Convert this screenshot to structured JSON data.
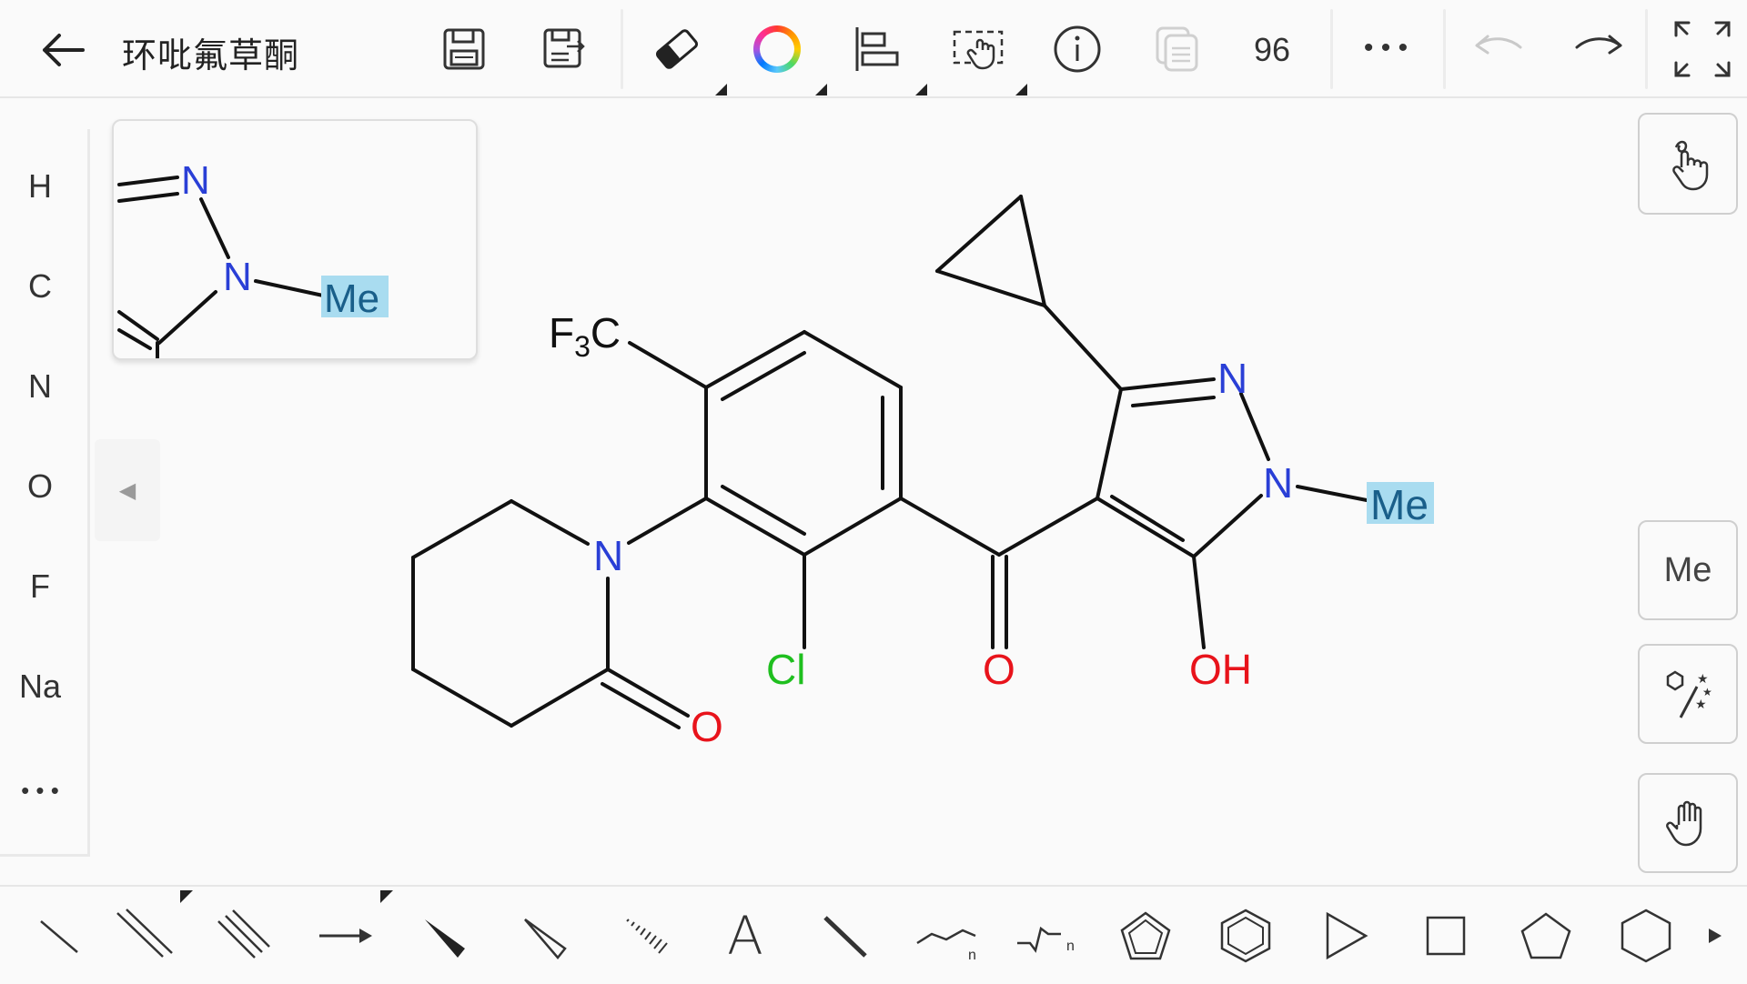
{
  "app": {
    "title": "环吡氟草酮",
    "zoom_level": "96"
  },
  "toolbar": {
    "icons": [
      "back-arrow-icon",
      "save-icon",
      "save-as-icon",
      "eraser-icon",
      "color-wheel-icon",
      "align-icon",
      "lasso-select-icon",
      "info-icon",
      "copy-icon",
      "more-icon",
      "undo-icon",
      "redo-icon",
      "fullscreen-icon"
    ],
    "more_label": "• • •"
  },
  "element_palette": {
    "items": [
      "H",
      "C",
      "N",
      "O",
      "F",
      "Na"
    ],
    "more_label": "• • •"
  },
  "collapse_tab": {
    "glyph": "◀"
  },
  "preview": {
    "atoms": {
      "n1": "N",
      "n2": "N",
      "me": "Me"
    }
  },
  "right_panel": {
    "me_button_label": "Me",
    "icons": [
      "touch-draw-icon",
      "magic-wand-icon",
      "hand-pan-icon"
    ]
  },
  "molecule": {
    "name": "环吡氟草酮",
    "labels": {
      "cf3_f": "F",
      "cf3_sub": "3",
      "cf3_c": "C",
      "piperidone_n": "N",
      "lactam_o": "O",
      "chloro": "Cl",
      "ketone_o": "O",
      "pyrazole_n2": "N",
      "pyrazole_n1": "N",
      "methyl": "Me",
      "hydroxyl": "OH"
    },
    "colors": {
      "bond": "#111111",
      "nitrogen": "#2a3fd6",
      "oxygen": "#e8131b",
      "chlorine": "#1fbf1f",
      "highlight": "#a9dcf0",
      "methyl_text": "#1a5f8a"
    }
  },
  "bottom_toolbar": {
    "tools": [
      "single-bond-icon",
      "double-bond-icon",
      "triple-bond-icon",
      "arrow-icon",
      "wedge-bond-icon",
      "hollow-wedge-icon",
      "hash-bond-icon",
      "text-tool-icon",
      "bold-bond-icon",
      "chain-icon",
      "chain-n-icon",
      "cyclopentadiene-icon",
      "benzene-icon",
      "triangle-icon",
      "square-icon",
      "pentagon-icon",
      "hexagon-icon",
      "scroll-right-icon"
    ],
    "text_tool_glyph": "A",
    "chain_sub": "n"
  }
}
